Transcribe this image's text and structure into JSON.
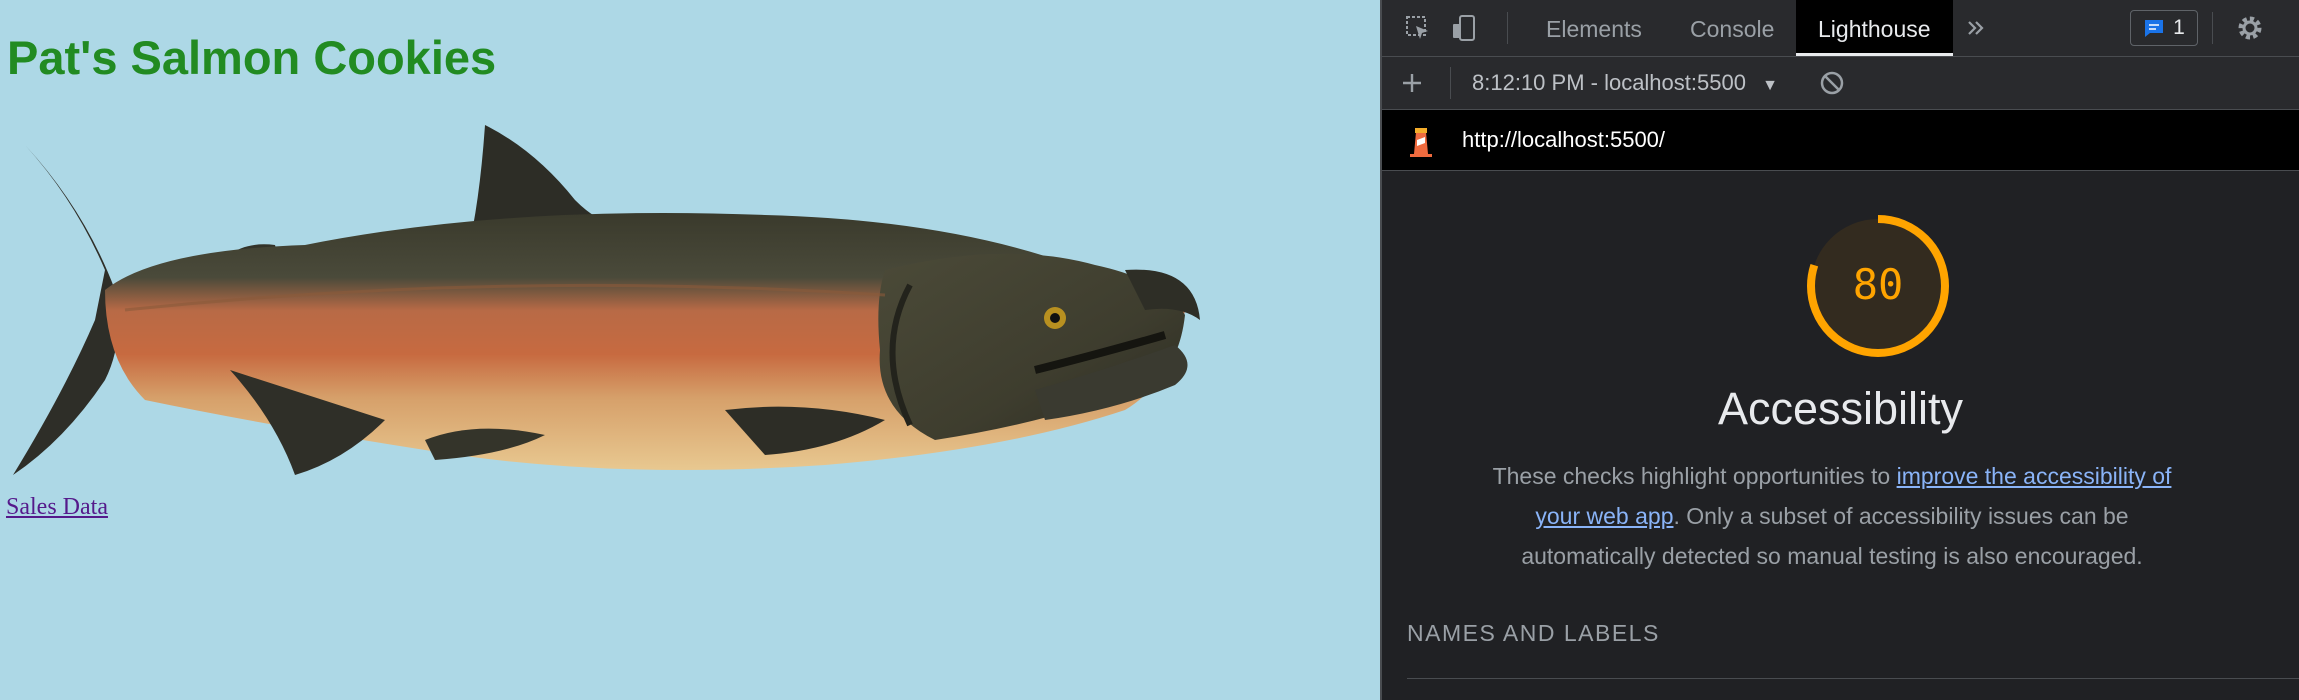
{
  "page": {
    "title": "Pat's Salmon Cookies",
    "link_text": "Sales Data"
  },
  "devtools": {
    "tabs": [
      {
        "label": "Elements",
        "active": false
      },
      {
        "label": "Console",
        "active": false
      },
      {
        "label": "Lighthouse",
        "active": true
      }
    ],
    "more_tabs_icon": "chevron-double-right-icon",
    "issues_count": "1",
    "settings_icon": "gear-icon",
    "run_label": "8:12:10 PM - localhost:5500",
    "report_url": "http://localhost:5500/",
    "score": "80",
    "score_value": 0.8,
    "score_color": "#ffa400",
    "category_title": "Accessibility",
    "description": {
      "before": "These checks highlight opportunities to ",
      "link": "improve the accessibility of your web app",
      "after": ". Only a subset of accessibility issues can be automatically detected so manual testing is also encouraged."
    },
    "group_title": "NAMES AND LABELS"
  }
}
